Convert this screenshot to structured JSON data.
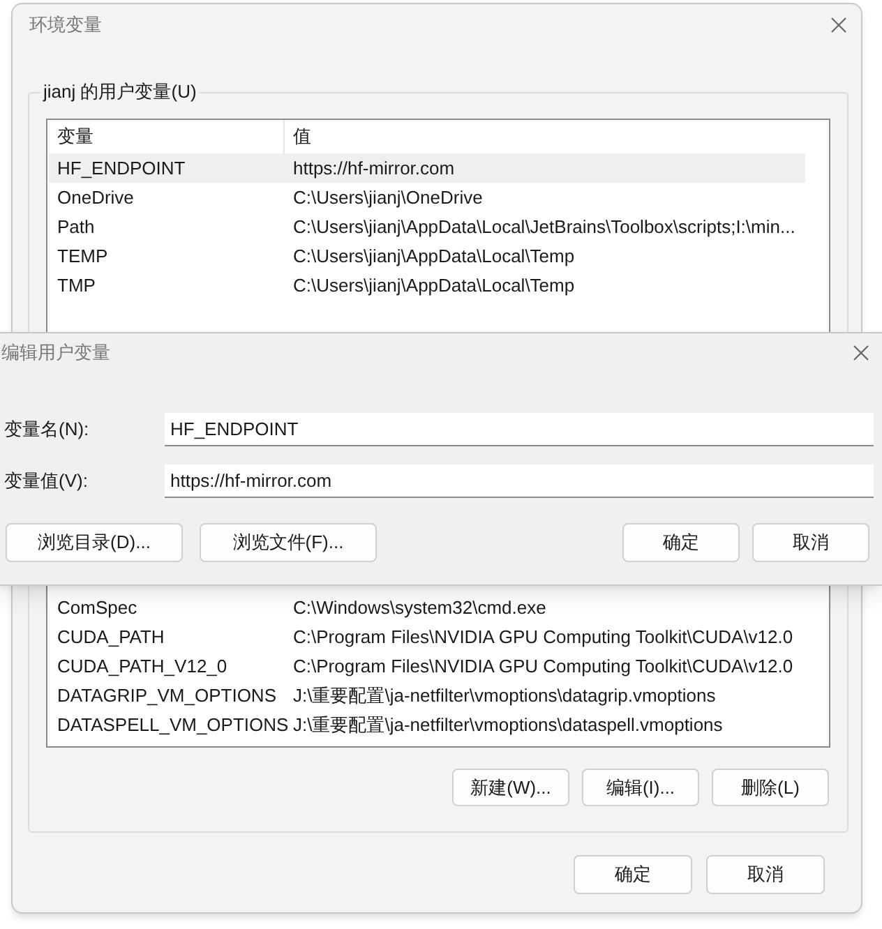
{
  "env_window": {
    "title": "环境变量",
    "user_group": {
      "label": "jianj 的用户变量(U)",
      "columns": [
        "变量",
        "值"
      ],
      "rows": [
        {
          "name": "HF_ENDPOINT",
          "value": "https://hf-mirror.com",
          "selected": true
        },
        {
          "name": "OneDrive",
          "value": "C:\\Users\\jianj\\OneDrive",
          "selected": false
        },
        {
          "name": "Path",
          "value": "C:\\Users\\jianj\\AppData\\Local\\JetBrains\\Toolbox\\scripts;I:\\min...",
          "selected": false
        },
        {
          "name": "TEMP",
          "value": "C:\\Users\\jianj\\AppData\\Local\\Temp",
          "selected": false
        },
        {
          "name": "TMP",
          "value": "C:\\Users\\jianj\\AppData\\Local\\Temp",
          "selected": false
        }
      ]
    },
    "system_rows": [
      {
        "name": "ComSpec",
        "value": "C:\\Windows\\system32\\cmd.exe"
      },
      {
        "name": "CUDA_PATH",
        "value": "C:\\Program Files\\NVIDIA GPU Computing Toolkit\\CUDA\\v12.0"
      },
      {
        "name": "CUDA_PATH_V12_0",
        "value": "C:\\Program Files\\NVIDIA GPU Computing Toolkit\\CUDA\\v12.0"
      },
      {
        "name": "DATAGRIP_VM_OPTIONS",
        "value": "J:\\重要配置\\ja-netfilter\\vmoptions\\datagrip.vmoptions"
      },
      {
        "name": "DATASPELL_VM_OPTIONS",
        "value": "J:\\重要配置\\ja-netfilter\\vmoptions\\dataspell.vmoptions"
      }
    ],
    "list_buttons": [
      "新建(W)...",
      "编辑(I)...",
      "删除(L)"
    ],
    "buttons": [
      "确定",
      "取消"
    ]
  },
  "edit_dialog": {
    "title": "编辑用户变量",
    "fields": [
      {
        "label": "变量名(N):",
        "value": "HF_ENDPOINT"
      },
      {
        "label": "变量值(V):",
        "value": "https://hf-mirror.com"
      }
    ],
    "browse_buttons": [
      "浏览目录(D)...",
      "浏览文件(F)..."
    ],
    "buttons": [
      "确定",
      "取消"
    ]
  }
}
